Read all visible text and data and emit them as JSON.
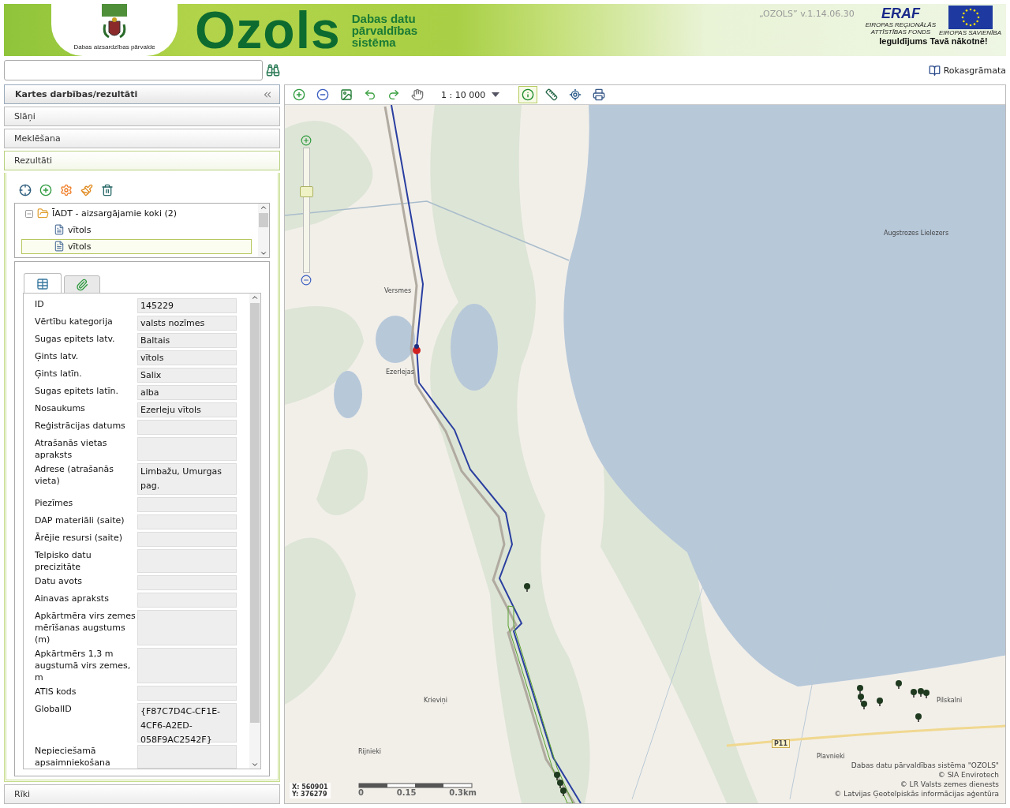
{
  "header": {
    "org_name": "Dabas aizsardzības pārvalde",
    "logo": "Ozols",
    "subtitle": [
      "Dabas datu",
      "pārvaldības",
      "sistēma"
    ],
    "version": "„OZOLS” v.1.14.06.30",
    "eraf": "ERAF",
    "eraf_fund": [
      "EIROPAS REĢIONĀLĀS",
      "ATTĪSTĪBAS FONDS"
    ],
    "eu": "EIROPAS SAVIENĪBA",
    "slogan": "Ieguldījums Tavā nākotnē!"
  },
  "help_link": "Rokasgrāmata",
  "sidebar": {
    "title": "Kartes darbības/rezultāti",
    "sections": [
      {
        "label": "Slāņi",
        "expanded": false
      },
      {
        "label": "Meklēšana",
        "expanded": false
      },
      {
        "label": "Rezultāti",
        "expanded": true
      },
      {
        "label": "Rīki",
        "expanded": false
      }
    ],
    "tree": {
      "label": "ĪADT - aizsargājamie koki (2)",
      "expanded": true,
      "children": [
        {
          "label": "vītols",
          "selected": false
        },
        {
          "label": "vītols",
          "selected": true
        }
      ]
    },
    "detail_tabs": [
      {
        "kind": "table",
        "selected": true
      },
      {
        "kind": "attachment",
        "selected": false
      }
    ],
    "fields": [
      {
        "label": "ID",
        "value": "145229"
      },
      {
        "label": "Vērtību kategorija",
        "value": "valsts nozīmes"
      },
      {
        "label": "Sugas epitets latv.",
        "value": "Baltais"
      },
      {
        "label": "Ģints latv.",
        "value": "vītols"
      },
      {
        "label": "Ģints latīn.",
        "value": "Salix"
      },
      {
        "label": "Sugas epitets latīn.",
        "value": "alba"
      },
      {
        "label": "Nosaukums",
        "value": "Ezerleju vītols"
      },
      {
        "label": "Reģistrācijas datums"
      },
      {
        "label": "Atrašanās vietas apraksts"
      },
      {
        "label": "Adrese (atrašanās vieta)",
        "value": "Limbažu, Umurgas pag."
      },
      {
        "label": "Piezīmes"
      },
      {
        "label": "DAP materiāli (saite)"
      },
      {
        "label": "Ārējie resursi (saite)"
      },
      {
        "label": "Telpisko datu precizitāte"
      },
      {
        "label": "Datu avots"
      },
      {
        "label": "Ainavas apraksts"
      },
      {
        "label": "Apkārtmēra virs zemes mērīšanas augstums (m)"
      },
      {
        "label": "Apkārtmērs 1,3 m augstumā virs zemes, m"
      },
      {
        "label": "ATIS kods"
      },
      {
        "label": "GlobalID",
        "value": "{F87C7D4C-CF1E-4CF6-A2ED-058F9AC2542F}"
      },
      {
        "label": "Nepieciešamā apsaimniekošana"
      }
    ]
  },
  "map": {
    "tools": [
      {
        "kind": "zoomin",
        "selected": false
      },
      {
        "kind": "zoomout",
        "selected": false
      },
      {
        "kind": "extent",
        "selected": false
      },
      {
        "kind": "back",
        "selected": false
      },
      {
        "kind": "forward",
        "selected": false
      },
      {
        "kind": "pan",
        "selected": false
      },
      {
        "kind": "scale",
        "label": "1 : 10 000",
        "selected": false
      },
      {
        "kind": "info",
        "selected": true
      },
      {
        "kind": "measure",
        "selected": false
      },
      {
        "kind": "xy",
        "selected": false
      },
      {
        "kind": "print",
        "selected": false
      }
    ],
    "zoom_slider": {
      "level": 0.67
    },
    "places": [
      "Versmes",
      "Ezerlejas",
      "Augstrozes Lielezers",
      "Krieviņi",
      "Rijnieki",
      "Pilskalni",
      "Plavnieki"
    ],
    "road_label": "P11",
    "coordinates": [
      "X: 560901",
      "Y: 376279"
    ],
    "scale_bar": [
      "0",
      "0.15",
      "0.3km"
    ],
    "attribution": [
      "Dabas datu pārvaldības sistēma \"OZOLS\"",
      "© SIA Envirotech",
      "© LR Valsts zemes dienests",
      "© Latvijas Ģeotelpiskās informācijas aģentūra"
    ]
  }
}
